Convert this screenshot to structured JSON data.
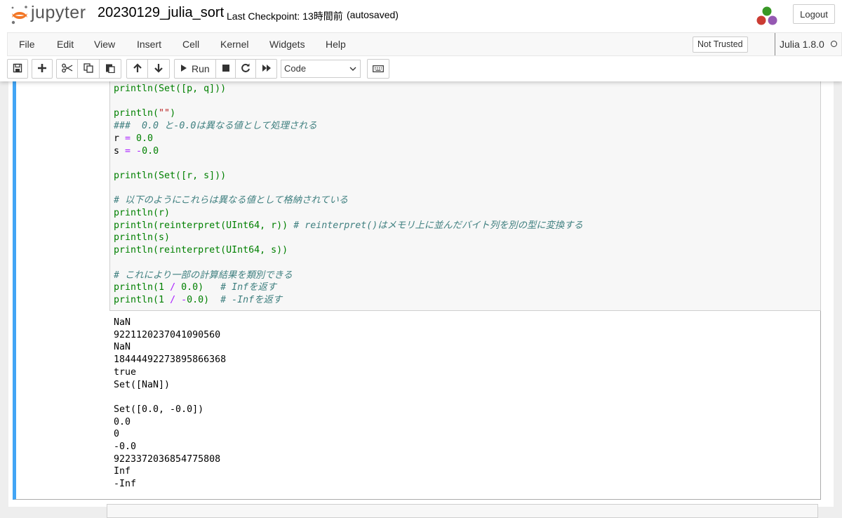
{
  "header": {
    "logo_text": "jupyter",
    "notebook_name": "20230129_julia_sort",
    "checkpoint": "Last Checkpoint: 13時間前",
    "autosave": "(autosaved)",
    "logout_label": "Logout"
  },
  "menubar": {
    "items": [
      "File",
      "Edit",
      "View",
      "Insert",
      "Cell",
      "Kernel",
      "Widgets",
      "Help"
    ],
    "trust_label": "Not Trusted",
    "kernel_label": "Julia 1.8.0"
  },
  "toolbar": {
    "run_label": "Run",
    "cell_type": "Code",
    "icons": [
      "save-icon",
      "plus-icon",
      "scissors-icon",
      "copy-icon",
      "paste-icon",
      "arrow-up-icon",
      "arrow-down-icon",
      "play-icon",
      "stop-icon",
      "restart-icon",
      "fast-forward-icon",
      "keyboard-icon"
    ]
  },
  "cell": {
    "code_lines": [
      [
        {
          "t": "println(Set([p, q]))",
          "c": "kw"
        }
      ],
      [],
      [
        {
          "t": "println(",
          "c": "kw"
        },
        {
          "t": "\"\"",
          "c": "str"
        },
        {
          "t": ")",
          "c": "kw"
        }
      ],
      [
        {
          "t": "###  0.0 と-0.0は異なる値として処理される",
          "c": "cm"
        }
      ],
      [
        {
          "t": "r ",
          "c": ""
        },
        {
          "t": "=",
          "c": "op"
        },
        {
          "t": " 0.0",
          "c": "num"
        }
      ],
      [
        {
          "t": "s ",
          "c": ""
        },
        {
          "t": "=",
          "c": "op"
        },
        {
          "t": " ",
          "c": ""
        },
        {
          "t": "-",
          "c": "op"
        },
        {
          "t": "0.0",
          "c": "num"
        }
      ],
      [],
      [
        {
          "t": "println(Set([r, s]))",
          "c": "kw"
        }
      ],
      [],
      [
        {
          "t": "# 以下のようにこれらは異なる値として格納されている",
          "c": "cm"
        }
      ],
      [
        {
          "t": "println(r)",
          "c": "kw"
        }
      ],
      [
        {
          "t": "println(reinterpret(UInt64, r)) ",
          "c": "kw"
        },
        {
          "t": "# reinterpret()はメモリ上に並んだバイト列を別の型に変換する",
          "c": "cm"
        }
      ],
      [
        {
          "t": "println(s)",
          "c": "kw"
        }
      ],
      [
        {
          "t": "println(reinterpret(UInt64, s))",
          "c": "kw"
        }
      ],
      [],
      [
        {
          "t": "# これにより一部の計算結果を類別できる",
          "c": "cm"
        }
      ],
      [
        {
          "t": "println(1 ",
          "c": "kw"
        },
        {
          "t": "/",
          "c": "op"
        },
        {
          "t": " 0.0)   ",
          "c": "kw"
        },
        {
          "t": "# Infを返す",
          "c": "cm"
        }
      ],
      [
        {
          "t": "println(1 ",
          "c": "kw"
        },
        {
          "t": "/",
          "c": "op"
        },
        {
          "t": " ",
          "c": "kw"
        },
        {
          "t": "-",
          "c": "op"
        },
        {
          "t": "0.0)  ",
          "c": "kw"
        },
        {
          "t": "# -Infを返す",
          "c": "cm"
        }
      ]
    ],
    "output_lines": [
      "NaN",
      "9221120237041090560",
      "NaN",
      "18444492273895866368",
      "true",
      "Set([NaN])",
      "",
      "Set([0.0, -0.0])",
      "0.0",
      "0",
      "-0.0",
      "9223372036854775808",
      "Inf",
      "-Inf"
    ]
  },
  "colors": {
    "cell_selected_border": "#42a5f5",
    "keyword": "#008000",
    "operator": "#aa22ff",
    "comment": "#408080",
    "string": "#ba2121"
  }
}
